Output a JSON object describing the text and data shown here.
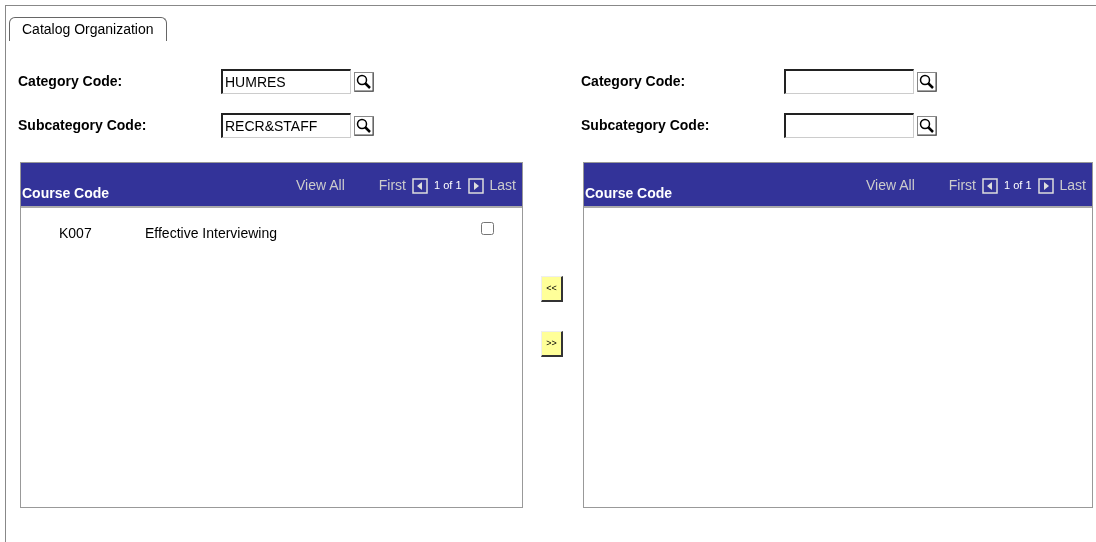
{
  "tabs": [
    {
      "label": "Catalog Organization",
      "selected": true
    }
  ],
  "source": {
    "fields": [
      {
        "label": "Category Code:",
        "value": "HUMRES"
      },
      {
        "label": "Subcategory Code:",
        "value": "RECR&STAFF"
      }
    ],
    "grid": {
      "column_title": "Course Code",
      "view_all": "View All",
      "first": "First",
      "page": "1 of 1",
      "last": "Last",
      "rows": [
        {
          "code": "K007",
          "description": "Effective Interviewing",
          "checked": false
        }
      ]
    }
  },
  "move_buttons": [
    "<<",
    ">>"
  ],
  "target": {
    "fields": [
      {
        "label": "Category Code:"
      },
      {
        "label": "Subcategory Code:"
      }
    ],
    "grid": {
      "column_title": "Course Code",
      "view_all": "View All",
      "first": "First",
      "page": "1 of 1",
      "last": "Last"
    }
  }
}
